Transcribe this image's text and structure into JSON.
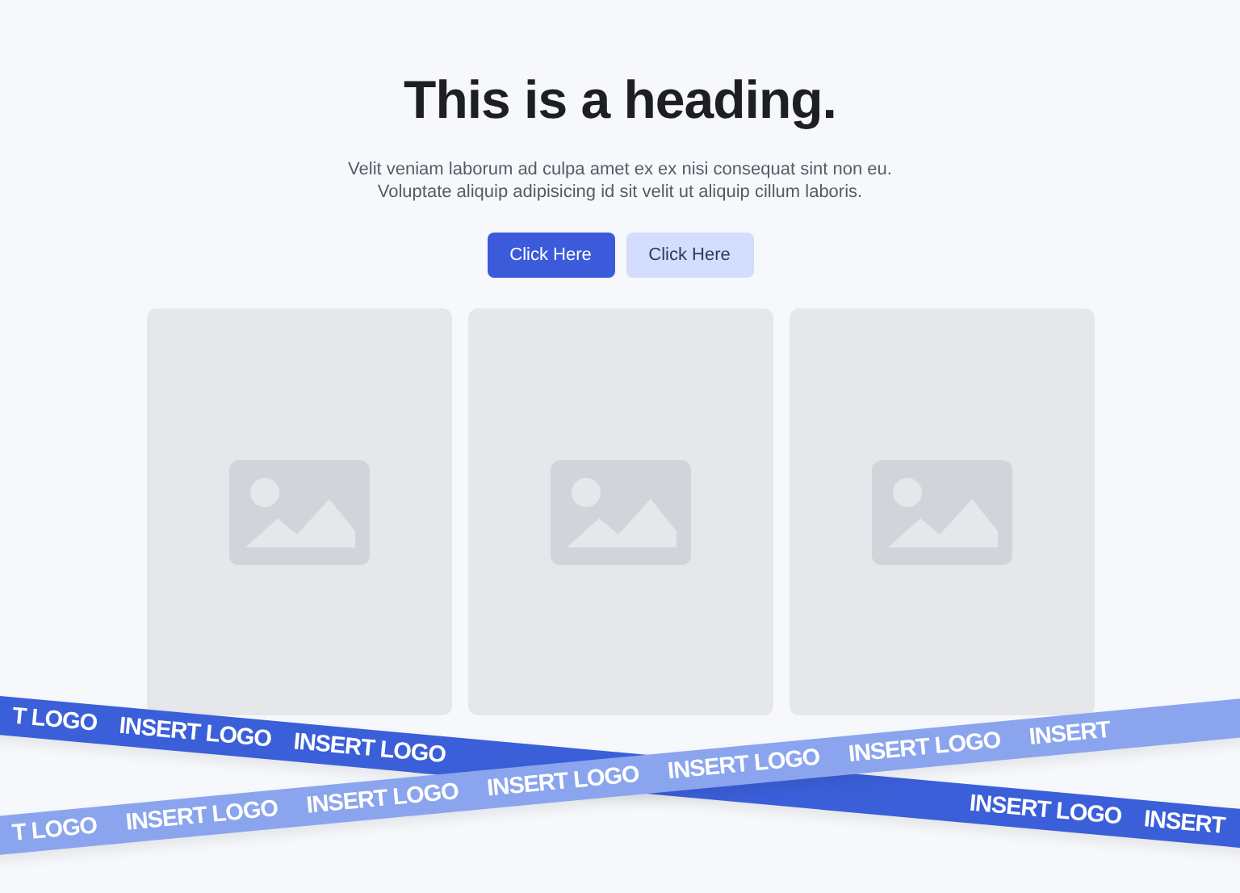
{
  "heading": "This is a heading.",
  "paragraph": [
    "Velit veniam laborum ad culpa amet ex ex nisi consequat sint non eu.",
    "Voluptate aliquip adipisicing id sit velit ut aliquip cillum laboris."
  ],
  "buttons": [
    {
      "label": "Click Here",
      "kind": "primary"
    },
    {
      "label": "Click Here",
      "kind": "secondary"
    }
  ],
  "cards": [
    {
      "kind": "picture"
    },
    {
      "kind": "picture"
    },
    {
      "kind": "picture"
    }
  ],
  "ribbons": [
    {
      "kind": "dark",
      "groups": [
        [
          "T LOGO",
          "INSERT LOGO",
          "INSERT LOGO"
        ],
        [
          "INSERT LOGO",
          "INSERT"
        ]
      ]
    },
    {
      "kind": "light",
      "groups": [
        [
          "T LOGO",
          "INSERT LOGO",
          "INSERT LOGO",
          "INSERT LOGO",
          "INSERT LOGO",
          "INSERT LOGO",
          "INSERT"
        ]
      ]
    }
  ]
}
